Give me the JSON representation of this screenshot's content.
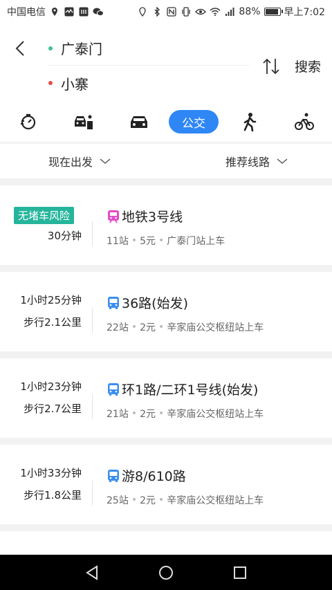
{
  "status_bar": {
    "carrier": "中国电信",
    "battery": "88%",
    "time": "早上7:02"
  },
  "header": {
    "start": "广泰门",
    "end": "小寨",
    "search_label": "搜索",
    "start_dot_color": "#3ec28f",
    "end_dot_color": "#e84d4d"
  },
  "modes": {
    "active_label": "公交",
    "items": [
      "timer-icon",
      "taxi-combo-icon",
      "car-icon",
      "bus-tab",
      "walk-icon",
      "bike-icon"
    ]
  },
  "filters": {
    "departure": "现在出发",
    "strategy": "推荐线路"
  },
  "routes": [
    {
      "badge": "无堵车风险",
      "duration": "30分钟",
      "walk": "",
      "icon": "subway-icon",
      "line": "地铁3号线",
      "stops": "11站",
      "price": "5元",
      "board": "广泰门站上车"
    },
    {
      "badge": "",
      "duration": "1小时25分钟",
      "walk": "步行2.1公里",
      "icon": "bus-icon",
      "line": "36路(始发)",
      "stops": "22站",
      "price": "2元",
      "board": "辛家庙公交枢纽站上车"
    },
    {
      "badge": "",
      "duration": "1小时23分钟",
      "walk": "步行2.7公里",
      "icon": "bus-icon",
      "line": "环1路/二环1号线(始发)",
      "stops": "21站",
      "price": "2元",
      "board": "辛家庙公交枢纽站上车"
    },
    {
      "badge": "",
      "duration": "1小时33分钟",
      "walk": "步行1.8公里",
      "icon": "bus-icon",
      "line": "游8/610路",
      "stops": "25站",
      "price": "2元",
      "board": "辛家庙公交枢纽站上车"
    }
  ],
  "colors": {
    "accent": "#2f87f5",
    "badge": "#25b59c",
    "subway": "#e44cc8",
    "bus": "#3b8ef0"
  }
}
